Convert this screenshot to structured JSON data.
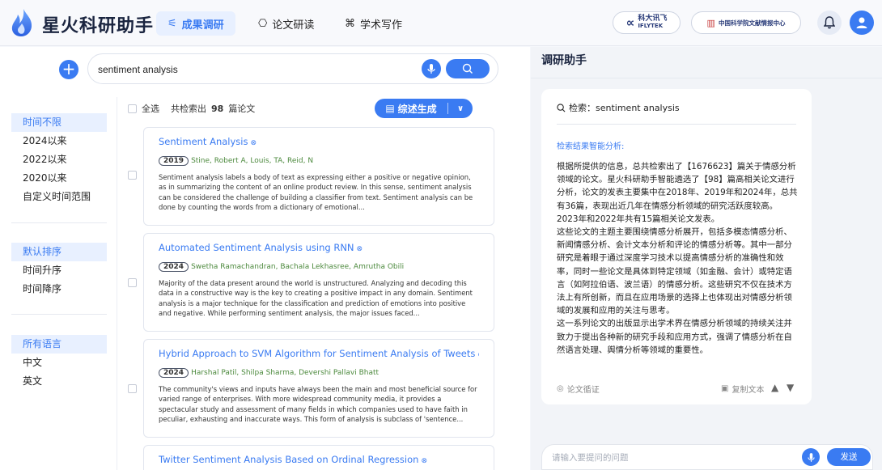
{
  "app": {
    "title": "星火科研助手"
  },
  "nav": {
    "tabs": [
      {
        "label": "成果调研",
        "icon": "filter-settings-icon",
        "active": true
      },
      {
        "label": "论文研读",
        "icon": "book-open-icon",
        "active": false
      },
      {
        "label": "学术写作",
        "icon": "pen-icon",
        "active": false
      }
    ]
  },
  "partners": [
    {
      "text": "科大讯飞",
      "sub": "IFLYTEK"
    },
    {
      "text": "中国科学院文献情报中心"
    }
  ],
  "search": {
    "query": "sentiment analysis"
  },
  "filters": {
    "time": [
      "时间不限",
      "2024以来",
      "2022以来",
      "2020以来",
      "自定义时间范围"
    ],
    "sort": [
      "默认排序",
      "时间升序",
      "时间降序"
    ],
    "lang": [
      "所有语言",
      "中文",
      "英文"
    ]
  },
  "toolbar": {
    "select_all": "全选",
    "count_prefix": "共检索出",
    "count": "98",
    "count_suffix": "篇论文",
    "summary_btn": "综述生成"
  },
  "papers": [
    {
      "title": "Sentiment Analysis",
      "year": "2019",
      "authors": "Stine, Robert A, Louis, TA, Reid, N",
      "abstract": "Sentiment analysis labels a body of text as expressing either a positive or negative opinion, as in summarizing the content of an online product review. In this sense, sentiment analysis can be considered the challenge of building a classifier from text. Sentiment analysis can be done by counting the words from a dictionary of emotional..."
    },
    {
      "title": "Automated Sentiment Analysis using RNN",
      "year": "2024",
      "authors": "Swetha Ramachandran, Bachala Lekhasree, Amrutha Obili",
      "abstract": "Majority of the data present around the world is unstructured. Analyzing and decoding this data in a constructive way is the key to creating a positive impact in any domain. Sentiment analysis is a major technique for the classification and prediction of emotions into positive and negative. While performing sentiment analysis, the major issues faced..."
    },
    {
      "title": "Hybrid Approach to SVM Algorithm for Sentiment Analysis of Tweets",
      "year": "2024",
      "authors": "Harshal Patil, Shilpa Sharma, Devershi Pallavi Bhatt",
      "abstract": "The community's views and inputs have always been the main and most beneficial source for varied range of enterprises. With more widespread community media, it provides a spectacular study and assessment of many fields in which companies used to have faith in peculiar, exhausting and inaccurate ways. This form of analysis is subclass of 'sentence..."
    },
    {
      "title": "Twitter Sentiment Analysis Based on Ordinal Regression"
    }
  ],
  "assistant": {
    "title": "调研助手",
    "query_label": "检索：sentiment analysis",
    "subheading": "检索结果智能分析:",
    "paragraphs": [
      "根据所提供的信息，总共检索出了【1676623】篇关于情感分析领域的论文。星火科研助手智能遴选了【98】篇高相关论文进行分析，论文的发表主要集中在2018年、2019年和2024年，总共有36篇，表现出近几年在情感分析领域的研究活跃度较高。2023年和2022年共有15篇相关论文发表。",
      "这些论文的主题主要围绕情感分析展开，包括多模态情感分析、新闻情感分析、会计文本分析和评论的情感分析等。其中一部分研究是着眼于通过深度学习技术以提高情感分析的准确性和效率，同时一些论文是具体到特定领域（如金融、会计）或特定语言（如阿拉伯语、波兰语）的情感分析。这些研究不仅在技术方法上有所创新，而且在应用场景的选择上也体现出对情感分析领域的发展和应用的关注与思考。",
      "这一系列论文的出版显示出学术界在情感分析领域的持续关注并致力于提出各种新的研究手段和应用方式，强调了情感分析在自然语言处理、舆情分析等领域的重要性。"
    ],
    "cite_label": "论文循证",
    "copy_label": "复制文本"
  },
  "chat": {
    "placeholder": "请输入要提问的问题",
    "send": "发送"
  },
  "colors": {
    "accent": "#3a7bf2",
    "author": "#4d8a3e"
  }
}
